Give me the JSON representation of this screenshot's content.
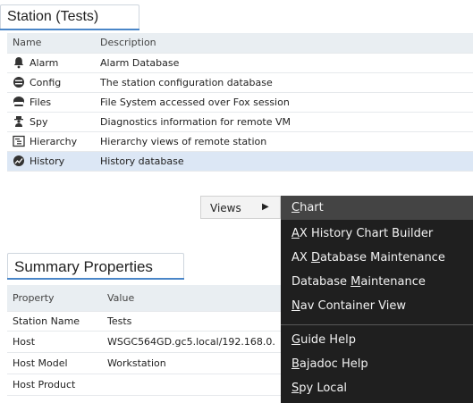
{
  "station_panel": {
    "tab_title": "Station (Tests)",
    "columns": [
      "Name",
      "Description"
    ],
    "rows": [
      {
        "name": "Alarm",
        "description": "Alarm Database",
        "icon": "bell-icon"
      },
      {
        "name": "Config",
        "description": "The station configuration database",
        "icon": "database-icon"
      },
      {
        "name": "Files",
        "description": "File System accessed over Fox session",
        "icon": "drive-icon"
      },
      {
        "name": "Spy",
        "description": "Diagnostics information for remote VM",
        "icon": "spy-icon"
      },
      {
        "name": "Hierarchy",
        "description": "Hierarchy views of remote station",
        "icon": "hierarchy-icon"
      },
      {
        "name": "History",
        "description": "History database",
        "icon": "history-icon",
        "selected": true
      }
    ]
  },
  "summary_panel": {
    "tab_title": "Summary Properties",
    "columns": [
      "Property",
      "Value"
    ],
    "rows": [
      {
        "property": "Station Name",
        "value": "Tests"
      },
      {
        "property": "Host",
        "value": "WSGC564GD.gc5.local/192.168.0."
      },
      {
        "property": "Host Model",
        "value": "Workstation"
      },
      {
        "property": "Host Product",
        "value": ""
      }
    ]
  },
  "context_menu": {
    "views_label": "Views",
    "submenu": [
      {
        "pre": "",
        "u": "C",
        "post": "hart"
      },
      {
        "pre": "",
        "u": "A",
        "post": "X History Chart Builder"
      },
      {
        "pre": "AX ",
        "u": "D",
        "post": "atabase Maintenance"
      },
      {
        "pre": "Database ",
        "u": "M",
        "post": "aintenance"
      },
      {
        "pre": "",
        "u": "N",
        "post": "av Container View"
      },
      {
        "pre": "",
        "u": "G",
        "post": "uide Help"
      },
      {
        "pre": "",
        "u": "B",
        "post": "ajadoc Help"
      },
      {
        "pre": "",
        "u": "S",
        "post": "py Local"
      }
    ]
  },
  "colors": {
    "selection": "#dce7f5",
    "accent": "#4a86c8",
    "menu_bg": "#1f1f1f"
  }
}
